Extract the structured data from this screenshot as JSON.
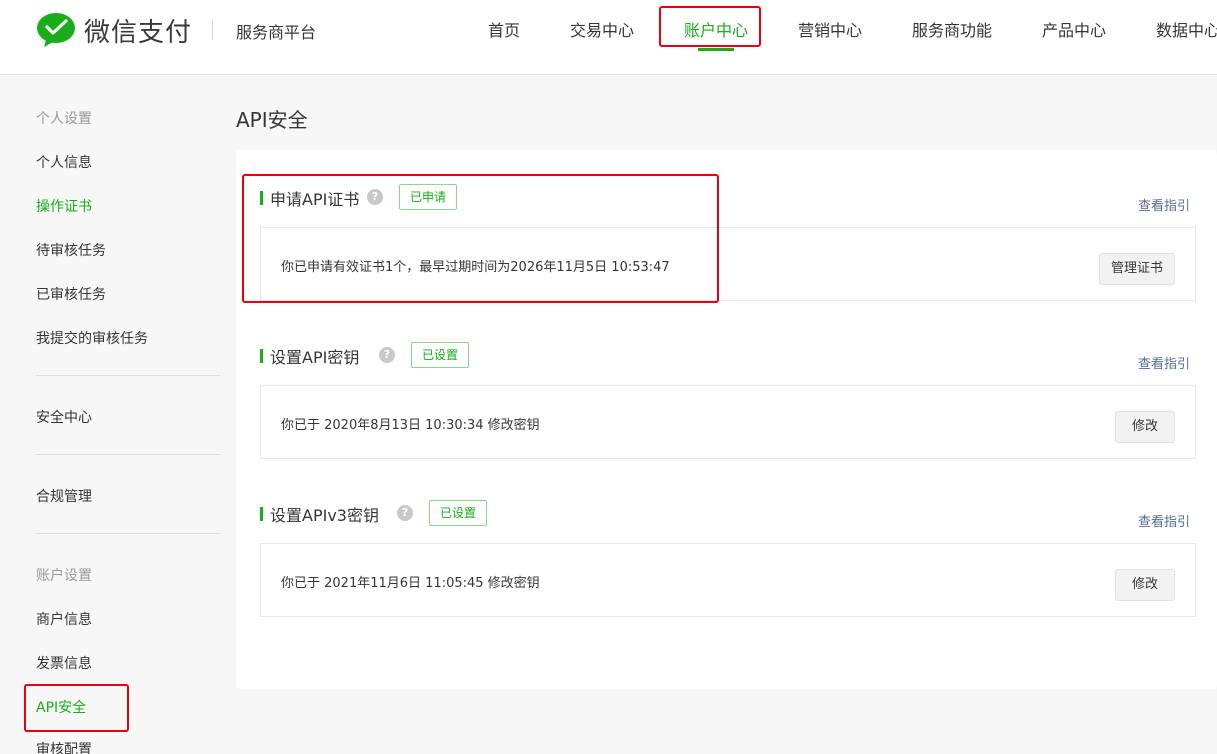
{
  "header": {
    "brand": "微信支付",
    "platform": "服务商平台",
    "nav": [
      {
        "label": "首页"
      },
      {
        "label": "交易中心"
      },
      {
        "label": "账户中心"
      },
      {
        "label": "营销中心"
      },
      {
        "label": "服务商功能"
      },
      {
        "label": "产品中心"
      },
      {
        "label": "数据中心"
      }
    ],
    "active_nav": "账户中心"
  },
  "sidebar": {
    "groups": [
      {
        "title": "个人设置",
        "items": [
          "个人信息",
          "操作证书",
          "待审核任务",
          "已审核任务",
          "我提交的审核任务"
        ]
      },
      {
        "items": [
          "安全中心"
        ]
      },
      {
        "items": [
          "合规管理"
        ]
      },
      {
        "title": "账户设置",
        "items": [
          "商户信息",
          "发票信息",
          "API安全",
          "审核配置"
        ]
      }
    ],
    "active_items": [
      "操作证书",
      "API安全"
    ]
  },
  "main": {
    "title": "API安全",
    "sections": [
      {
        "title": "申请API证书",
        "status": "已申请",
        "guide": "查看指引",
        "info": "你已申请有效证书1个，最早过期时间为2026年11月5日 10:53:47",
        "action": "管理证书"
      },
      {
        "title": "设置API密钥",
        "status": "已设置",
        "guide": "查看指引",
        "info": "你已于 2020年8月13日 10:30:34 修改密钥",
        "action": "修改"
      },
      {
        "title": "设置APIv3密钥",
        "status": "已设置",
        "guide": "查看指引",
        "info": "你已于 2021年11月6日 11:05:45 修改密钥",
        "action": "修改"
      }
    ]
  },
  "colors": {
    "accent": "#1aad19",
    "link": "#576b95",
    "highlight": "#e60012"
  },
  "icons": {
    "logo": "wechat-pay-logo",
    "help": "question-circle-icon"
  }
}
